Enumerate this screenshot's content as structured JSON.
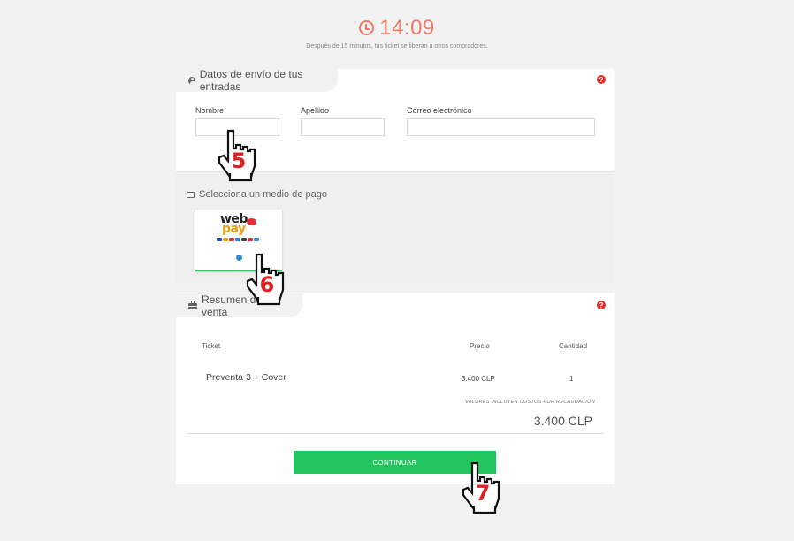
{
  "timer": {
    "time": "14:09",
    "note": "Después de 15 minutos, tus ticket se liberan a otros compradores."
  },
  "shipping": {
    "title": "Datos de envío de tus entradas",
    "help": "?",
    "fields": [
      {
        "label": "Nombre",
        "value": ""
      },
      {
        "label": "Apellido",
        "value": ""
      },
      {
        "label": "Correo electrónico",
        "value": ""
      }
    ]
  },
  "payment": {
    "title": "Selecciona un medio de pago",
    "methods": [
      {
        "logo_text": "web",
        "logo_text2": "pay"
      }
    ]
  },
  "summary": {
    "title": "Resumen de venta",
    "help": "?",
    "columns": [
      "Ticket",
      "Precio",
      "Cantidad"
    ],
    "items": [
      {
        "ticket": "Preventa 3 + Cover",
        "price": "3.400 CLP",
        "quantity": "1"
      }
    ],
    "fee_note": "VALORES INCLUYEN COSTOS POR RECAUDACIÓN",
    "total": "3.400 CLP",
    "continue_label": "CONTINUAR"
  },
  "step_markers": [
    "5",
    "6",
    "7"
  ],
  "colors": {
    "timer": "#f07a6a",
    "accent_green": "#22c55e",
    "help_red": "#e0302a",
    "marker_red": "#e02020"
  }
}
